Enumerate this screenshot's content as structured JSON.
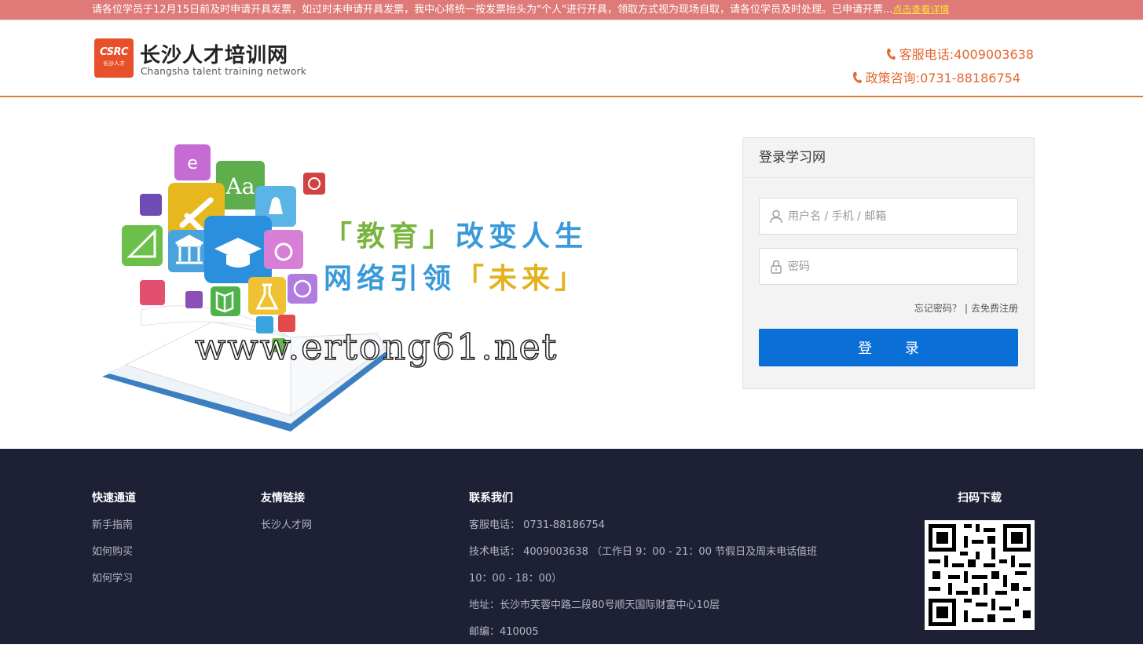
{
  "notice": {
    "text": "请各位学员于12月15日前及时申请开具发票，如过时未申请开具发票，我中心将统一按发票抬头为\"个人\"进行开具，领取方式视为现场自取，请各位学员及时处理。已申请开票...",
    "link": "点击查看详情"
  },
  "header": {
    "logo_abbr": "CSRC",
    "logo_sub": "长沙人才",
    "title": "长沙人才培训网",
    "subtitle": "Changsha talent training network",
    "phone1": "客服电话:4009003638",
    "phone2": "政策咨询:0731-88186754"
  },
  "hero": {
    "slogan1_a": "「教育」",
    "slogan1_b": "改变人生",
    "slogan2_a": "网络引领",
    "slogan2_b": "「未来」",
    "watermark": "www.ertong61.net"
  },
  "login": {
    "title": "登录学习网",
    "username_placeholder": "用户名 / 手机 / 邮箱",
    "password_placeholder": "密码",
    "forgot": "忘记密码？",
    "separator": "|",
    "register": "去免费注册",
    "button": "登 录"
  },
  "footer": {
    "quick": {
      "title": "快速通道",
      "items": [
        "新手指南",
        "如何购买",
        "如何学习"
      ]
    },
    "links": {
      "title": "友情链接",
      "items": [
        "长沙人才网"
      ]
    },
    "contact": {
      "title": "联系我们",
      "items": [
        "客服电话： 0731-88186754",
        "技术电话： 4009003638 （工作日 9：00 - 21：00 节假日及周末电话值班",
        "10：00 - 18：00）",
        "地址：长沙市芙蓉中路二段80号顺天国际财富中心10层",
        "邮编：410005"
      ]
    },
    "qr": {
      "title": "扫码下载"
    }
  },
  "colors": {
    "notice_bg": "#de7a78",
    "accent_orange": "#e2672f",
    "button_blue": "#0b6fd8",
    "footer_bg": "#1e2036"
  }
}
